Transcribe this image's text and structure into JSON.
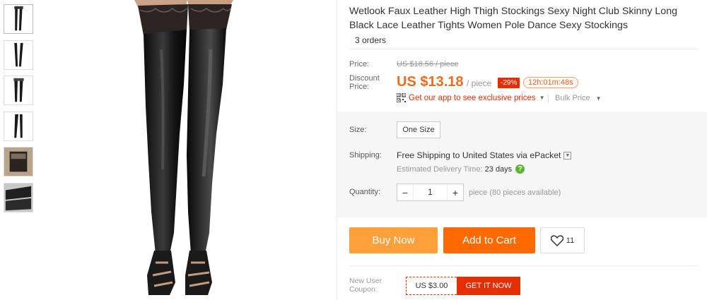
{
  "product": {
    "title": "Wetlook Faux Leather High Thigh Stockings Sexy Night Club Skinny Long Black Lace Leather Tights Women Pole Dance Sexy Stockings",
    "orders": "3 orders"
  },
  "price": {
    "price_label": "Price:",
    "original": "US $18.56 / piece",
    "discount_label_1": "Discount",
    "discount_label_2": "Price:",
    "current": "US $13.18",
    "unit": "/ piece",
    "discount_pct": "-29%",
    "countdown": "12h:01m:48s",
    "app_promo": "Get our app to see exclusive prices",
    "bulk": "Bulk Price"
  },
  "options": {
    "size_label": "Size:",
    "size_value": "One Size"
  },
  "shipping": {
    "label": "Shipping:",
    "free": "Free Shipping to",
    "destination": "United States via ePacket",
    "delivery_label": "Estimated Delivery Time:",
    "delivery_days": "23 days",
    "help": "?"
  },
  "quantity": {
    "label": "Quantity:",
    "minus": "−",
    "value": "1",
    "plus": "+",
    "available": "piece (80 pieces available)"
  },
  "actions": {
    "buy_now": "Buy Now",
    "add_to_cart": "Add to Cart",
    "wishlist_count": "11"
  },
  "coupon": {
    "label_1": "New User",
    "label_2": "Coupon:",
    "amount": "US $3.00",
    "cta": "GET IT NOW"
  },
  "colors": {
    "accent_orange": "#ff6a00",
    "buy_now_orange": "#ffa03b",
    "price_orange": "#f06c1e",
    "badge_red": "#e62e04"
  }
}
